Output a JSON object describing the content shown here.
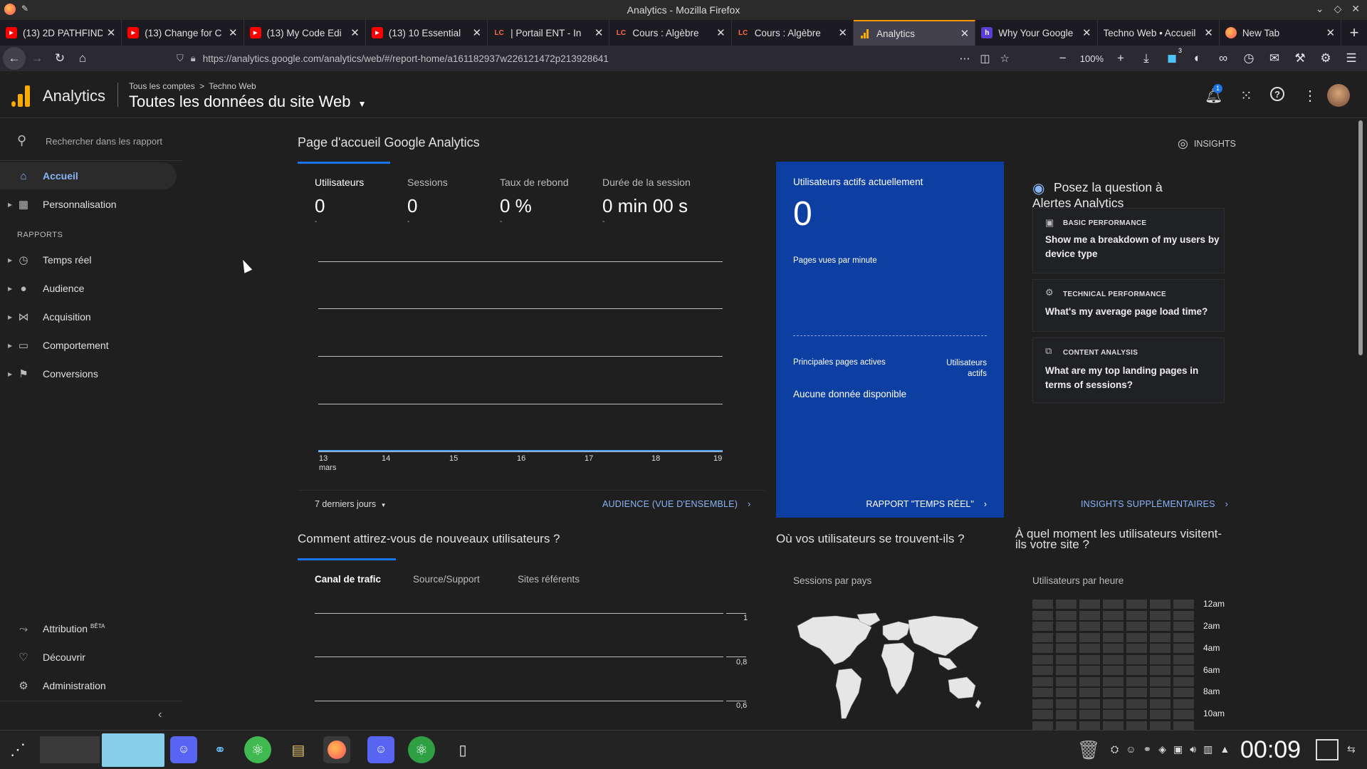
{
  "window": {
    "title": "Analytics - Mozilla Firefox"
  },
  "tabs": [
    {
      "title": "(13) 2D PATHFIND",
      "icon": "youtube-icon"
    },
    {
      "title": "(13) Change for C",
      "icon": "youtube-icon"
    },
    {
      "title": "(13) My Code Edi",
      "icon": "youtube-icon"
    },
    {
      "title": "(13) 10 Essential",
      "icon": "youtube-icon"
    },
    {
      "title": "| Portail ENT - In",
      "icon": "lc-icon"
    },
    {
      "title": "Cours : Algèbre",
      "icon": "lc-icon"
    },
    {
      "title": "Cours : Algèbre",
      "icon": "lc-icon"
    },
    {
      "title": "Analytics",
      "icon": "analytics-icon"
    },
    {
      "title": "Why Your Google",
      "icon": "h-icon"
    },
    {
      "title": "Techno Web • Accueil",
      "icon": "none"
    },
    {
      "title": "New Tab",
      "icon": "firefox-icon"
    }
  ],
  "url": "https://analytics.google.com/analytics/web/#/report-home/a161182937w226121472p213928641",
  "zoom": "100%",
  "addon_badge": "3",
  "header": {
    "app_name": "Analytics",
    "breadcrumb_root": "Tous les comptes",
    "breadcrumb_sep": ">",
    "breadcrumb_account": "Techno Web",
    "property": "Toutes les données du site Web",
    "notif_count": "1"
  },
  "sidebar": {
    "search_placeholder": "Rechercher dans les rapport",
    "home": "Accueil",
    "customization": "Personnalisation",
    "reports_heading": "RAPPORTS",
    "realtime": "Temps réel",
    "audience": "Audience",
    "acquisition": "Acquisition",
    "behavior": "Comportement",
    "conversions": "Conversions",
    "attribution": "Attribution",
    "beta": "BÊTA",
    "discover": "Découvrir",
    "admin": "Administration"
  },
  "main": {
    "page_title": "Page d'accueil Google Analytics",
    "insights_btn": "INSIGHTS",
    "metrics": [
      {
        "label": "Utilisateurs",
        "value": "0",
        "delta": "-"
      },
      {
        "label": "Sessions",
        "value": "0",
        "delta": "-"
      },
      {
        "label": "Taux de rebond",
        "value": "0 %",
        "delta": "-"
      },
      {
        "label": "Durée de la session",
        "value": "0 min 00 s",
        "delta": "-"
      }
    ],
    "x_ticks": [
      "13",
      "14",
      "15",
      "16",
      "17",
      "18",
      "19"
    ],
    "x_month": "mars",
    "date_range": "7 derniers jours",
    "audience_link": "AUDIENCE (VUE D'ENSEMBLE)",
    "realtime": {
      "title": "Utilisateurs actifs actuellement",
      "value": "0",
      "pageviews_label": "Pages vues par minute",
      "top_pages_label": "Principales pages actives",
      "active_users_label_1": "Utilisateurs",
      "active_users_label_2": "actifs",
      "no_data": "Aucune donnée disponible",
      "link": "RAPPORT \"TEMPS RÉEL\""
    },
    "insights": {
      "title_1": "Posez la question à",
      "title_2": "Alertes Analytics",
      "cards": [
        {
          "category": "BASIC PERFORMANCE",
          "q1": "Show me a breakdown of my users by",
          "q2": "device type"
        },
        {
          "category": "TECHNICAL PERFORMANCE",
          "q1": "What's my average page load time?",
          "q2": ""
        },
        {
          "category": "CONTENT ANALYSIS",
          "q1": "What are my top landing pages in",
          "q2": "terms of sessions?"
        }
      ],
      "more_link": "INSIGHTS SUPPLÉMENTAIRES"
    },
    "acquisition": {
      "title": "Comment attirez-vous de nouveaux utilisateurs ?",
      "tabs": [
        "Canal de trafic",
        "Source/Support",
        "Sites référents"
      ],
      "y_ticks": [
        "1",
        "0,8",
        "0,6"
      ]
    },
    "geo": {
      "title": "Où vos utilisateurs se trouvent-ils ?",
      "subtitle": "Sessions par pays"
    },
    "time": {
      "title_1": "À quel moment les utilisateurs visitent-",
      "title_2": "ils votre site ?",
      "subtitle": "Utilisateurs par heure",
      "hours": [
        "12am",
        "2am",
        "4am",
        "6am",
        "8am",
        "10am"
      ]
    }
  },
  "taskbar": {
    "clock": "00:09"
  },
  "colors": {
    "accent": "#8ab4f8",
    "realtime_bg": "#0d3ea2",
    "ga_orange": "#f9ab00",
    "tab_active": "#ff9400"
  }
}
